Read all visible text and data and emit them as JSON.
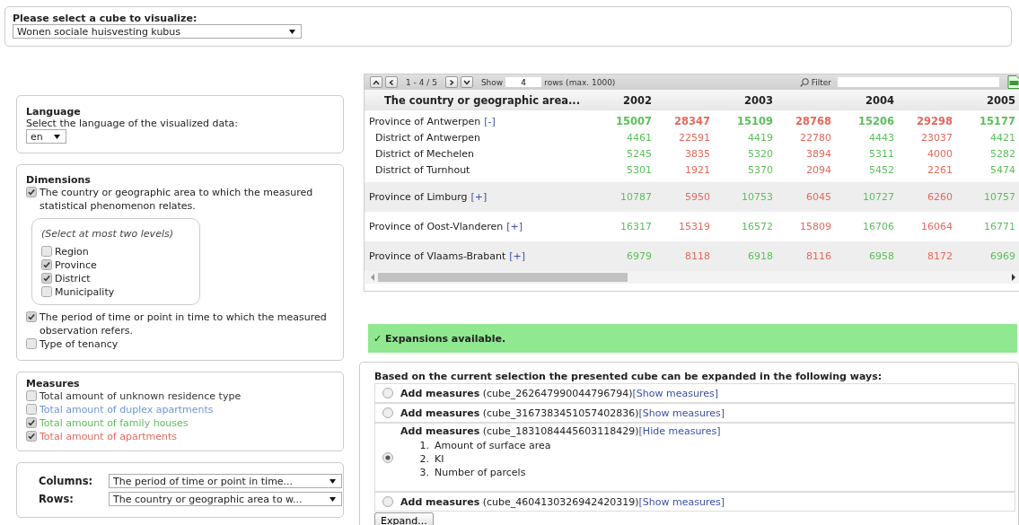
{
  "cube_selector": {
    "label": "Please select a cube to visualize:",
    "value": "Wonen sociale huisvesting kubus"
  },
  "language": {
    "title": "Language",
    "prompt": "Select the language of the visualized data:",
    "value": "en"
  },
  "dimensions": {
    "title": "Dimensions",
    "items": [
      {
        "label": "The country or geographic area to which the measured statistical phenomenon relates.",
        "checked": true,
        "levels": {
          "hint": "(Select at most two levels)",
          "items": [
            {
              "label": "Region",
              "checked": false
            },
            {
              "label": "Province",
              "checked": true
            },
            {
              "label": "District",
              "checked": true
            },
            {
              "label": "Municipality",
              "checked": false
            }
          ]
        }
      },
      {
        "label": "The period of time or point in time to which the measured observation refers.",
        "checked": true
      },
      {
        "label": "Type of tenancy",
        "checked": false
      }
    ]
  },
  "measures": {
    "title": "Measures",
    "items": [
      {
        "label": "Total amount of unknown residence type",
        "checked": false,
        "color": "#333333"
      },
      {
        "label": "Total amount of duplex apartments",
        "checked": false,
        "color": "#6f95d9"
      },
      {
        "label": "Total amount of family houses",
        "checked": true,
        "color": "#5cbf5c"
      },
      {
        "label": "Total amount of apartments",
        "checked": true,
        "color": "#e5685c"
      }
    ]
  },
  "axes": [
    {
      "label": "Columns:",
      "value": "The period of time or point in time..."
    },
    {
      "label": "Rows:",
      "value": "The country or geographic area to w..."
    }
  ],
  "table": {
    "toolbar": {
      "range": "1 - 4 / 5",
      "show_label": "Show",
      "rows_value": "4",
      "rows_note": "rows (max. 1000)",
      "filter_label": "Filter"
    },
    "columns": [
      "The country or geographic area...",
      "2002",
      "2003",
      "2004",
      "2005"
    ],
    "rows": [
      {
        "label": "Province of Antwerpen",
        "toggle": "[-]",
        "values": [
          "15007",
          "28347",
          "15109",
          "28768",
          "15206",
          "29298",
          "15177"
        ],
        "children": [
          {
            "label": "District of Antwerpen",
            "values": [
              "4461",
              "22591",
              "4419",
              "22780",
              "4443",
              "23037",
              "4421"
            ]
          },
          {
            "label": "District of Mechelen",
            "values": [
              "5245",
              "3835",
              "5320",
              "3894",
              "5311",
              "4000",
              "5282"
            ]
          },
          {
            "label": "District of Turnhout",
            "values": [
              "5301",
              "1921",
              "5370",
              "2094",
              "5452",
              "2261",
              "5474"
            ]
          }
        ]
      },
      {
        "label": "Province of Limburg",
        "toggle": "[+]",
        "values": [
          "10787",
          "5950",
          "10753",
          "6045",
          "10727",
          "6260",
          "10757"
        ]
      },
      {
        "label": "Province of Oost-Vlanderen",
        "toggle": "[+]",
        "values": [
          "16317",
          "15319",
          "16572",
          "15809",
          "16706",
          "16064",
          "16771"
        ]
      },
      {
        "label": "Province of Vlaams-Brabant",
        "toggle": "[+]",
        "values": [
          "6979",
          "8118",
          "6918",
          "8116",
          "6958",
          "8172",
          "6969"
        ]
      }
    ]
  },
  "notice": {
    "kind": "success",
    "text": "✓ Expansions available."
  },
  "expansions": {
    "intro": "Based on the current selection the presented cube can be expanded in the following ways:",
    "options": [
      {
        "text": "**Add measures** (cube_262647990044796794)",
        "link": "[Show measures]",
        "selected": false
      },
      {
        "text": "**Add measures** (cube_3167383451057402836)",
        "link": "[Show measures]",
        "selected": false
      },
      {
        "text": "**Add measures** (cube_1831084445603118429)",
        "link": "[Hide measures]",
        "selected": true,
        "measures": [
          {
            "number": "1.",
            "name": "Amount of surface area"
          },
          {
            "number": "2.",
            "name": "KI"
          },
          {
            "number": "3.",
            "name": "Number of parcels"
          }
        ]
      },
      {
        "text": "**Add measures** (cube_4604130326942420319)",
        "link": "[Show measures]",
        "selected": false
      }
    ],
    "button": "Expand..."
  }
}
